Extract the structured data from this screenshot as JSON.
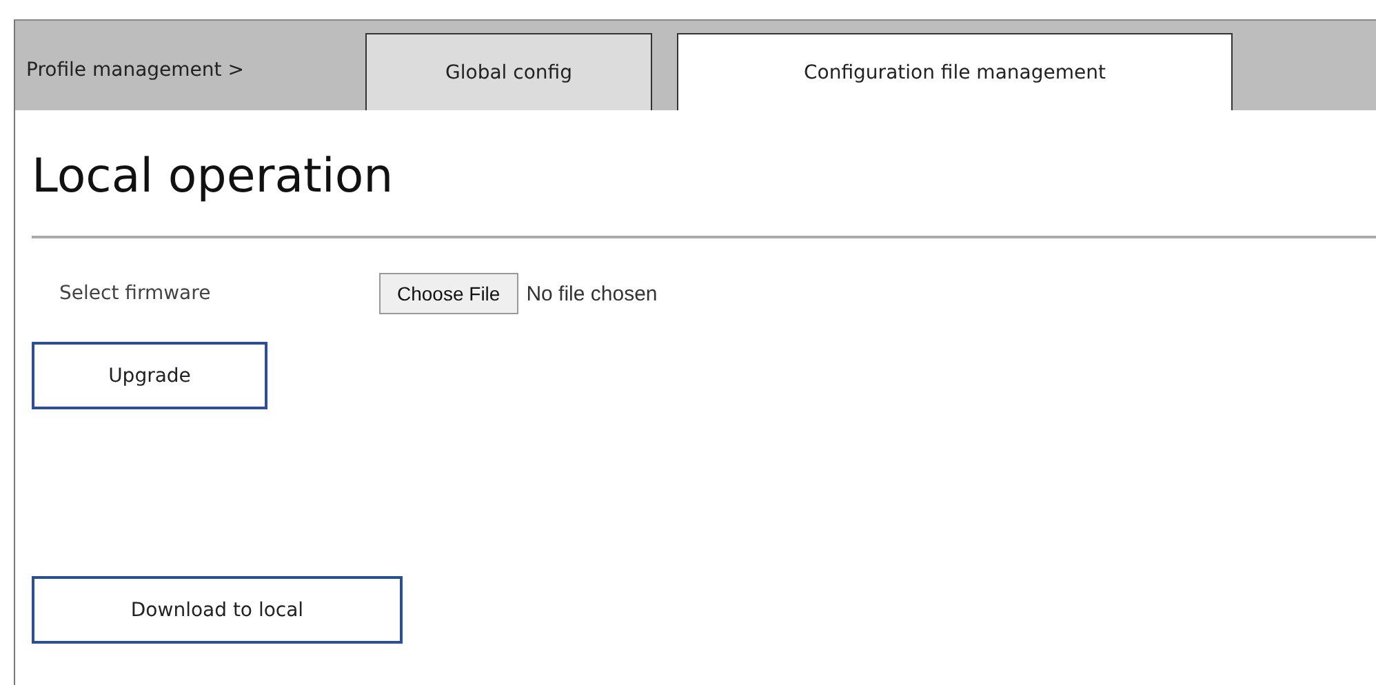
{
  "breadcrumb": "Profile management >",
  "tabs": [
    {
      "label": "Global config",
      "selected": false
    },
    {
      "label": "Configuration file management",
      "selected": true
    }
  ],
  "heading": "Local operation",
  "firmware": {
    "label": "Select firmware",
    "button": "Choose File",
    "status": "No file chosen"
  },
  "upgrade_button": "Upgrade",
  "download_button": "Download to local"
}
